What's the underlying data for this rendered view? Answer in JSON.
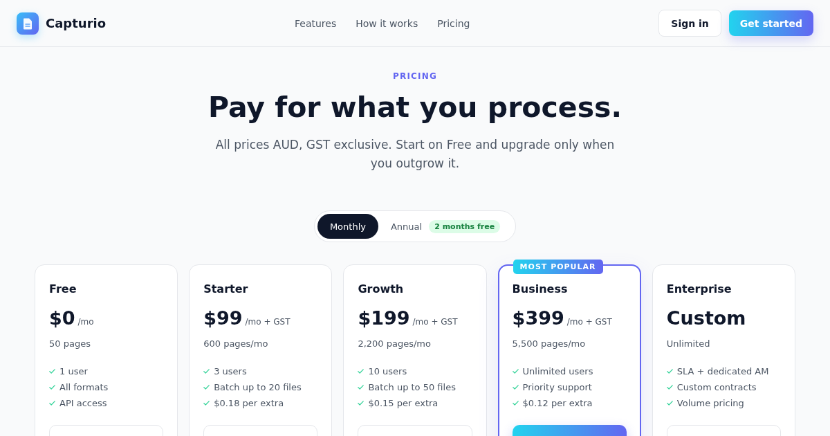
{
  "header": {
    "brand": "Capturio",
    "nav": [
      {
        "label": "Features"
      },
      {
        "label": "How it works"
      },
      {
        "label": "Pricing"
      }
    ],
    "actions": [
      {
        "label": "Sign in",
        "kind": "secondary"
      },
      {
        "label": "Get started",
        "kind": "primary"
      }
    ]
  },
  "hero": {
    "eyebrow": "PRICING",
    "title": "Pay for what you process.",
    "subtitle": "All prices AUD, GST exclusive. Start on Free and upgrade only when you outgrow it."
  },
  "billing_toggle": {
    "options": [
      {
        "label": "Monthly",
        "selected": true
      },
      {
        "label": "Annual",
        "selected": false,
        "badge": "2 months free"
      }
    ]
  },
  "plans": [
    {
      "name": "Free",
      "price": "$0",
      "period": "/mo",
      "quota": "50 pages",
      "features": [
        "1 user",
        "All formats",
        "API access"
      ],
      "featured": false
    },
    {
      "name": "Starter",
      "price": "$99",
      "period": "/mo + GST",
      "quota": "600 pages/mo",
      "features": [
        "3 users",
        "Batch up to 20 files",
        "$0.18 per extra"
      ],
      "featured": false
    },
    {
      "name": "Growth",
      "price": "$199",
      "period": "/mo + GST",
      "quota": "2,200 pages/mo",
      "features": [
        "10 users",
        "Batch up to 50 files",
        "$0.15 per extra"
      ],
      "featured": false
    },
    {
      "name": "Business",
      "badge": "MOST POPULAR",
      "price": "$399",
      "period": "/mo + GST",
      "quota": "5,500 pages/mo",
      "features": [
        "Unlimited users",
        "Priority support",
        "$0.12 per extra"
      ],
      "featured": true
    },
    {
      "name": "Enterprise",
      "price": "Custom",
      "quota": "Unlimited",
      "features": [
        "SLA + dedicated AM",
        "Custom contracts",
        "Volume pricing"
      ],
      "featured": false
    }
  ]
}
